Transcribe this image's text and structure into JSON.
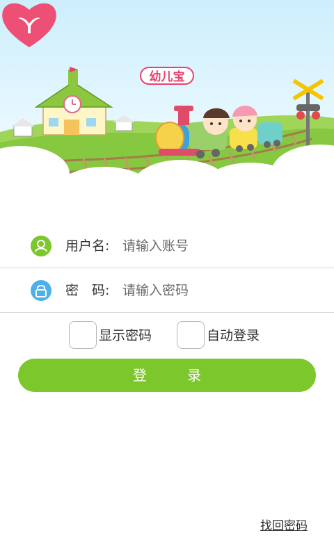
{
  "header": {
    "logo_text": "幼儿宝"
  },
  "form": {
    "username_label": "用户名:",
    "username_placeholder": "请输入账号",
    "password_label": "密　码:",
    "password_placeholder": "请输入密码"
  },
  "options": {
    "show_password_label": "显示密码",
    "show_password_checked": false,
    "auto_login_label": "自动登录",
    "auto_login_checked": false
  },
  "actions": {
    "login_label": "登 录",
    "forgot_password_label": "找回密码"
  },
  "colors": {
    "brand_green": "#7cc72b",
    "brand_pink": "#e9416d",
    "lock_blue": "#4db0ea"
  },
  "icons": {
    "username": "user-icon",
    "password": "lock-icon"
  }
}
